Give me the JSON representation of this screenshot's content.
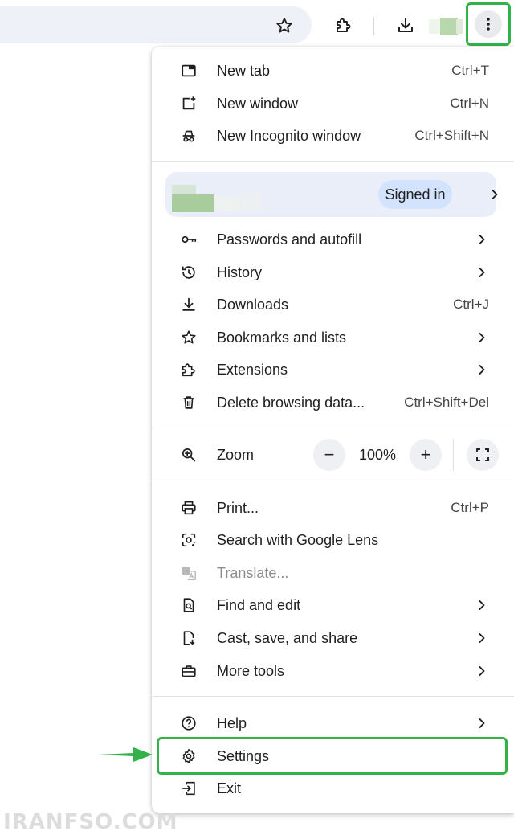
{
  "toolbar": {
    "icons": [
      "star-icon",
      "extensions-icon",
      "download-icon",
      "avatar",
      "more-vert-icon"
    ]
  },
  "menu": {
    "group1": [
      {
        "label": "New tab",
        "shortcut": "Ctrl+T",
        "icon": "new-tab-icon"
      },
      {
        "label": "New window",
        "shortcut": "Ctrl+N",
        "icon": "new-window-icon"
      },
      {
        "label": "New Incognito window",
        "shortcut": "Ctrl+Shift+N",
        "icon": "incognito-icon"
      }
    ],
    "profile": {
      "status": "Signed in"
    },
    "group2": [
      {
        "label": "Passwords and autofill",
        "icon": "key-icon"
      },
      {
        "label": "History",
        "icon": "history-icon"
      },
      {
        "label": "Downloads",
        "shortcut": "Ctrl+J",
        "icon": "download-icon"
      },
      {
        "label": "Bookmarks and lists",
        "icon": "star-icon"
      },
      {
        "label": "Extensions",
        "icon": "extensions-icon"
      },
      {
        "label": "Delete browsing data...",
        "shortcut": "Ctrl+Shift+Del",
        "icon": "trash-icon"
      }
    ],
    "zoom": {
      "label": "Zoom",
      "value": "100%",
      "minus": "−",
      "plus": "+"
    },
    "group3": [
      {
        "label": "Print...",
        "shortcut": "Ctrl+P",
        "icon": "print-icon"
      },
      {
        "label": "Search with Google Lens",
        "icon": "lens-icon"
      },
      {
        "label": "Translate...",
        "icon": "translate-icon",
        "disabled": true
      },
      {
        "label": "Find and edit",
        "icon": "find-icon"
      },
      {
        "label": "Cast, save, and share",
        "icon": "cast-icon"
      },
      {
        "label": "More tools",
        "icon": "toolbox-icon"
      }
    ],
    "group4": [
      {
        "label": "Help",
        "icon": "help-icon"
      },
      {
        "label": "Settings",
        "icon": "gear-icon"
      },
      {
        "label": "Exit",
        "icon": "exit-icon"
      }
    ]
  },
  "watermark": "IRANFSO.COM",
  "colors": {
    "highlight": "#34b24a",
    "signed_in_pill": "#d3e3fd",
    "profile_row": "#e9eef8"
  }
}
